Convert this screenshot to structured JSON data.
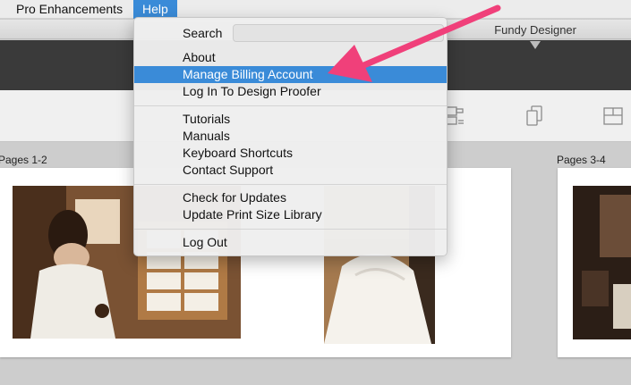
{
  "menubar": {
    "items": [
      {
        "label": "Pro Enhancements"
      },
      {
        "label": "Help"
      }
    ]
  },
  "window": {
    "title": "Fundy Designer"
  },
  "help_menu": {
    "search_label": "Search",
    "search_value": "",
    "groups": [
      [
        "About",
        "Manage Billing Account",
        "Log In To Design Proofer"
      ],
      [
        "Tutorials",
        "Manuals",
        "Keyboard Shortcuts",
        "Contact Support"
      ],
      [
        "Check for Updates",
        "Update Print Size Library"
      ],
      [
        "Log Out"
      ]
    ],
    "highlighted_item": "Manage Billing Account"
  },
  "workspace": {
    "spreads": [
      {
        "label": "Pages 1-2"
      },
      {
        "label": "Pages 3-4"
      }
    ]
  },
  "toolbar_icons": [
    "layout-grid-icon",
    "pages-stack-icon",
    "template-icon"
  ],
  "annotation": {
    "type": "arrow",
    "color": "#f0407a",
    "points_to": "Manage Billing Account"
  },
  "colors": {
    "menu_highlight": "#3a8bd8",
    "dark_toolbar": "#3a3a3a",
    "arrow": "#f0407a"
  }
}
